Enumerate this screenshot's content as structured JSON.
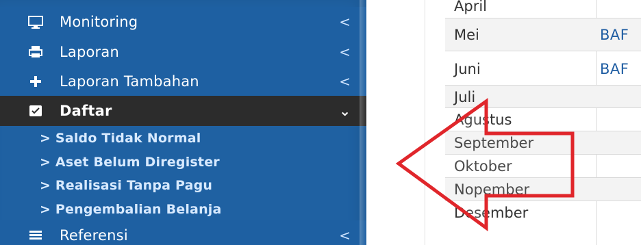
{
  "sidebar": {
    "items": [
      {
        "label": "Monitoring",
        "icon": "monitor-icon",
        "chevron": "<"
      },
      {
        "label": "Laporan",
        "icon": "printer-icon",
        "chevron": "<"
      },
      {
        "label": "Laporan Tambahan",
        "icon": "plus-icon",
        "chevron": "<"
      },
      {
        "label": "Daftar",
        "icon": "check-square-icon",
        "chevron": "⌄"
      },
      {
        "label": "Referensi",
        "icon": "list-icon",
        "chevron": "<"
      }
    ],
    "submenu": [
      "> Saldo Tidak Normal",
      "> Aset Belum Diregister",
      "> Realisasi Tanpa Pagu",
      "> Pengembalian Belanja"
    ]
  },
  "table": {
    "rows": [
      {
        "month": "April",
        "doc": ""
      },
      {
        "month": "Mei",
        "doc": "BAF"
      },
      {
        "month": "Juni",
        "doc": "BAF"
      },
      {
        "month": "Juli",
        "doc": ""
      },
      {
        "month": "Agustus",
        "doc": ""
      },
      {
        "month": "September",
        "doc": ""
      },
      {
        "month": "Oktober",
        "doc": ""
      },
      {
        "month": "Nopember",
        "doc": ""
      },
      {
        "month": "Desember",
        "doc": ""
      }
    ]
  },
  "annotation": {
    "arrow_color": "#e0262b",
    "direction": "left"
  },
  "colors": {
    "sidebar_blue": "#1f61a2",
    "active_item": "#2c2c2c",
    "link_blue": "#1f5da2"
  }
}
